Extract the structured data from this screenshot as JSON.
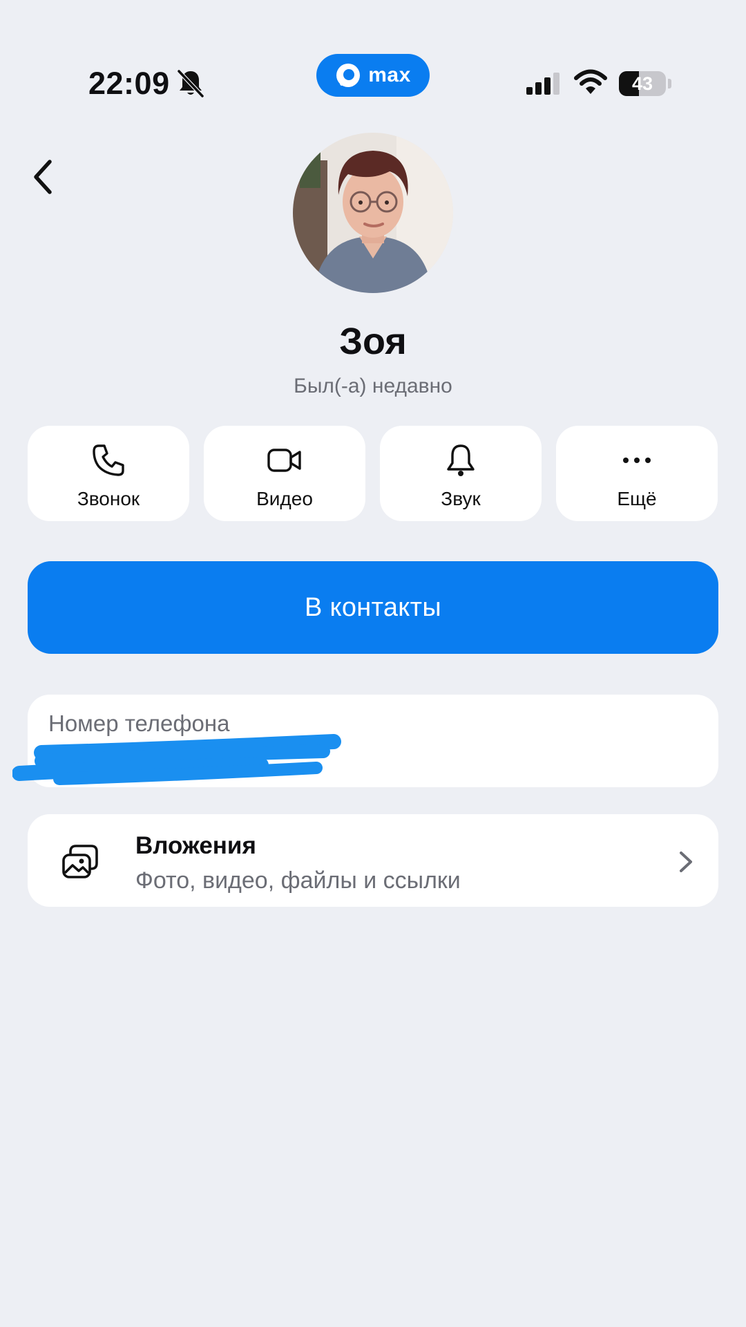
{
  "status_bar": {
    "time": "22:09",
    "battery_percent": "43",
    "battery_level": 0.43,
    "icons": [
      "bell-slash-icon",
      "cellular-signal-icon",
      "wifi-icon",
      "battery-icon"
    ]
  },
  "app_badge": {
    "label": "max",
    "icon": "max-logo-icon",
    "color": "#0a7df0"
  },
  "header": {
    "back_icon": "chevron-left-icon"
  },
  "profile": {
    "name": "Зоя",
    "last_seen": "Был(-а) недавно"
  },
  "actions": [
    {
      "label": "Звонок",
      "icon": "phone-icon"
    },
    {
      "label": "Видео",
      "icon": "video-camera-icon"
    },
    {
      "label": "Звук",
      "icon": "bell-icon"
    },
    {
      "label": "Ещё",
      "icon": "more-dots-icon"
    }
  ],
  "primary_button": {
    "label": "В контакты",
    "color": "#0a7df0"
  },
  "phone_card": {
    "label": "Номер телефона",
    "value_redacted": true
  },
  "attachments": {
    "title": "Вложения",
    "subtitle": "Фото, видео, файлы и ссылки",
    "icon": "photo-gallery-icon"
  },
  "colors": {
    "background": "#edeff4",
    "card": "#ffffff",
    "accent": "#0a7df0",
    "secondary_text": "#6b6d75"
  }
}
